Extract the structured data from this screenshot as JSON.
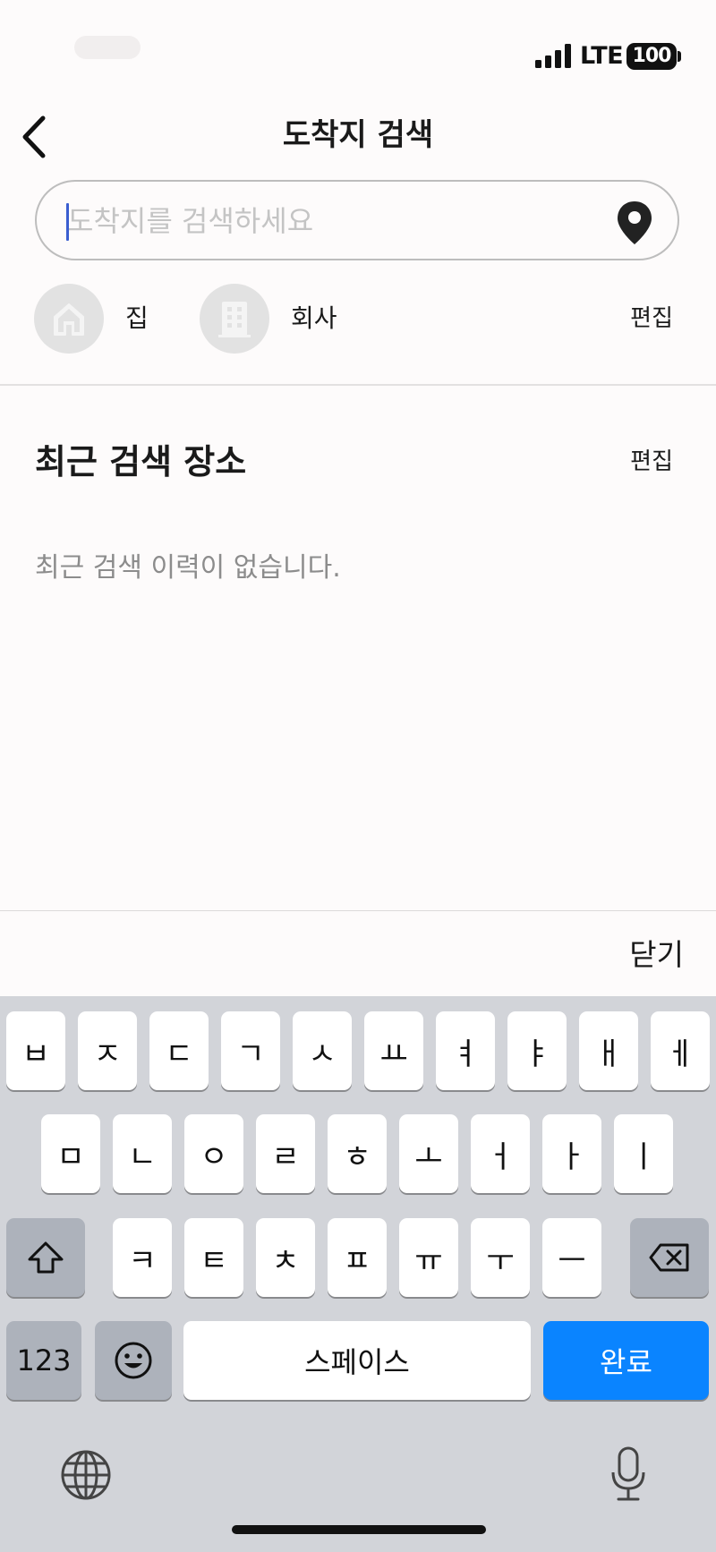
{
  "status_bar": {
    "network": "LTE",
    "battery": "100"
  },
  "header": {
    "title": "도착지 검색",
    "back_icon": "chevron-left-icon"
  },
  "search": {
    "placeholder": "도착지를 검색하세요",
    "value": "",
    "pin_icon": "map-pin-icon"
  },
  "quick_places": {
    "items": [
      {
        "label": "집",
        "icon": "home-icon"
      },
      {
        "label": "회사",
        "icon": "building-icon"
      }
    ],
    "edit_label": "편집"
  },
  "recent": {
    "title": "최근 검색 장소",
    "edit_label": "편집",
    "empty_message": "최근 검색 이력이 없습니다."
  },
  "keyboard_toolbar": {
    "close_label": "닫기"
  },
  "keyboard": {
    "row1": [
      "ㅂ",
      "ㅈ",
      "ㄷ",
      "ㄱ",
      "ㅅ",
      "ㅛ",
      "ㅕ",
      "ㅑ",
      "ㅐ",
      "ㅔ"
    ],
    "row2": [
      "ㅁ",
      "ㄴ",
      "ㅇ",
      "ㄹ",
      "ㅎ",
      "ㅗ",
      "ㅓ",
      "ㅏ",
      "ㅣ"
    ],
    "row3": [
      "ㅋ",
      "ㅌ",
      "ㅊ",
      "ㅍ",
      "ㅠ",
      "ㅜ",
      "ㅡ"
    ],
    "numbers_label": "123",
    "space_label": "스페이스",
    "done_label": "완료",
    "shift_icon": "shift-arrow-icon",
    "delete_icon": "backspace-icon",
    "emoji_icon": "emoji-icon",
    "globe_icon": "globe-icon",
    "mic_icon": "microphone-icon"
  },
  "colors": {
    "accent": "#0a84ff",
    "keyboard_bg": "#d2d4d9",
    "caret": "#3a5ed0"
  }
}
